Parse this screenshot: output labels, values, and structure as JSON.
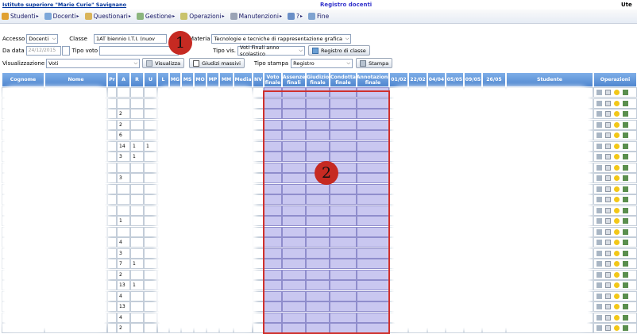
{
  "header": {
    "school": "Istituto superiore \"Marie Curie\" Savignano",
    "title": "Registro docenti",
    "user_label": "Ute"
  },
  "menu": [
    {
      "label": "Studenti",
      "icon": "users-icon"
    },
    {
      "label": "Docenti",
      "icon": "teacher-icon"
    },
    {
      "label": "Questionari",
      "icon": "questionnaire-icon"
    },
    {
      "label": "Gestione",
      "icon": "management-icon"
    },
    {
      "label": "Operazioni",
      "icon": "operations-icon"
    },
    {
      "label": "Manutenzioni",
      "icon": "maintenance-icon"
    },
    {
      "label": "?",
      "icon": "help-icon"
    },
    {
      "label": "Fine",
      "icon": "exit-icon"
    }
  ],
  "filters": {
    "accesso_label": "Accesso",
    "accesso_value": "Docenti",
    "classe_label": "Classe",
    "classe_value": "1AT biennio I.T.I. (nuov",
    "materia_label": "Materia",
    "materia_value": "Tecnologie e tecniche di rappresentazione grafica",
    "da_data_label": "Da data",
    "da_data_value": "24/12/2015",
    "tipo_voto_label": "Tipo voto",
    "tipo_vis_label": "Tipo vis.",
    "tipo_vis_value": "Voti Finali anno scolastico",
    "registro_classe_btn": "Registro di classe",
    "visualizzazione_label": "Visualizzazione",
    "visualizzazione_value": "Voti",
    "visualizza_btn": "Visualizza",
    "giudizi_btn": "Giudizi massivi",
    "tipo_stampa_label": "Tipo stampa",
    "tipo_stampa_value": "Registro",
    "stampa_btn": "Stampa"
  },
  "table": {
    "headers": {
      "cognome": "Cognome",
      "nome": "Nome",
      "pr": "Pr",
      "a": "A",
      "r": "R",
      "u": "U",
      "l": "L",
      "mg": "MG",
      "ms": "MS",
      "mo": "MO",
      "mp": "MP",
      "mm": "MM",
      "media": "Media",
      "nv": "NV",
      "voto_finale": "Voto finale",
      "assenze_finali": "Assenze finali",
      "giudizio_finale": "Giudizio finale",
      "condotta_finale": "Condotta finale",
      "annotazioni_finale": "Annotazioni finale",
      "d1": "01/02",
      "d2": "22/02",
      "d3": "04/04",
      "d4": "05/05",
      "d5": "09/05",
      "d6": "26/05",
      "studente": "Studente",
      "operazioni": "Operazioni"
    },
    "a_values": [
      "",
      "",
      "2",
      "2",
      "6",
      "14",
      "3",
      "",
      "3",
      "",
      "",
      "",
      "1",
      "",
      "4",
      "3",
      "7",
      "2",
      "13",
      "4",
      "13",
      "4",
      "2"
    ],
    "r_values": [
      "",
      "",
      "",
      "",
      "",
      "1",
      "1",
      "",
      "",
      "",
      "",
      "",
      "",
      "",
      "",
      "",
      "1",
      "",
      "1",
      "",
      "",
      "",
      ""
    ],
    "u_values": [
      "",
      "",
      "",
      "",
      "",
      "1",
      "",
      "",
      "",
      "",
      "",
      "",
      "",
      "",
      "",
      "",
      "",
      "",
      "",
      "",
      "",
      "",
      ""
    ]
  },
  "callouts": {
    "one": "1",
    "two": "2"
  }
}
